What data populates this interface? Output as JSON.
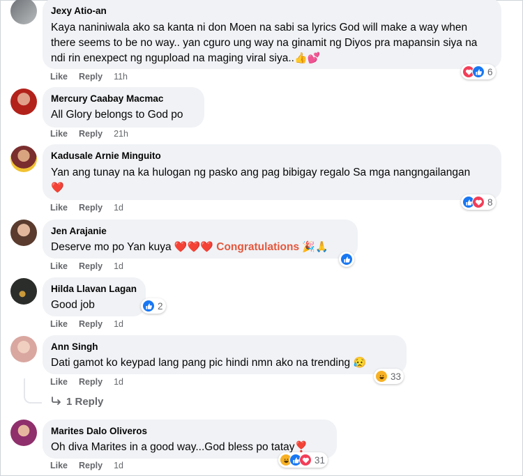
{
  "actions": {
    "like": "Like",
    "reply": "Reply"
  },
  "comments": [
    {
      "name": "Jexy Atio-an",
      "text": "Kaya naniniwala ako sa kanta ni don Moen na sabi sa lyrics God will make a way when there seems to be no way.. yan cguro ung way na ginamit ng Diyos pra mapansin siya na ndi rin enexpect ng ngupload na maging viral siya..",
      "emoji": "👍💕",
      "time": "11h",
      "reactions": [
        "love",
        "like"
      ],
      "reaction_count": "6"
    },
    {
      "name": "Mercury Caabay Macmac",
      "text": "All Glory belongs to God po",
      "time": "21h"
    },
    {
      "name": "Kadusale Arnie Minguito",
      "text": "Yan ang tunay na ka hulogan ng pasko ang pag bibigay regalo Sa mga nangngailangan",
      "emoji": "❤️",
      "time": "1d",
      "reactions": [
        "like",
        "love"
      ],
      "reaction_count": "8"
    },
    {
      "name": "Jen Arajanie",
      "text": "Deserve mo po Yan kuya",
      "hearts": "❤️❤️❤️",
      "highlight": "Congratulations",
      "emoji": "🎉🙏",
      "time": "1d",
      "reactions": [
        "like"
      ]
    },
    {
      "name": "Hilda Llavan Lagan",
      "text": "Good job",
      "time": "1d",
      "reactions": [
        "like"
      ],
      "reaction_count": "2"
    },
    {
      "name": "Ann Singh",
      "text": "Dati gamot ko keypad lang pang pic hindi nmn ako na trending",
      "emoji": "😥",
      "time": "1d",
      "reactions": [
        "haha"
      ],
      "reaction_count": "33"
    },
    {
      "name": "Marites Dalo Oliveros",
      "text": "Oh diva Marites in a good way...God bless po tatay",
      "emoji": "❣️",
      "time": "1d",
      "reactions": [
        "haha",
        "like",
        "love"
      ],
      "reaction_count": "31"
    }
  ],
  "replies_link": "1 Reply",
  "colors": {
    "like": "#1877f2",
    "love": "#f33e58",
    "haha": "#f7b125",
    "bubble": "#f0f2f5",
    "meta": "#65676b"
  }
}
